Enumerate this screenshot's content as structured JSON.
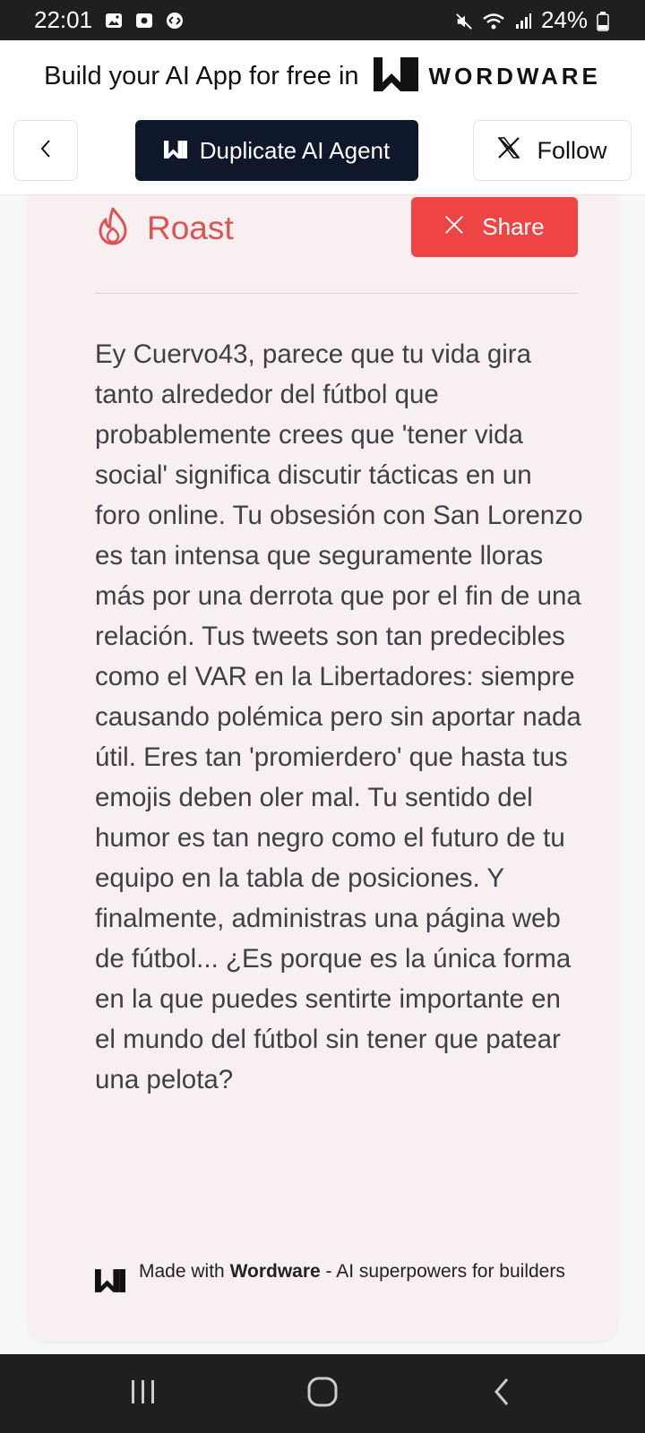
{
  "status_bar": {
    "time": "22:01",
    "battery": "24%",
    "icons": [
      "gallery-icon",
      "screen-record-icon",
      "shazam-icon",
      "mute-icon",
      "wifi-icon",
      "signal-icon",
      "battery-icon"
    ]
  },
  "banner": {
    "text": "Build your AI App for free in",
    "brand": "WORDWARE"
  },
  "action_bar": {
    "duplicate_label": "Duplicate AI Agent",
    "follow_label": "Follow"
  },
  "card": {
    "title": "Roast",
    "share_label": "Share",
    "body": "Ey Cuervo43, parece que tu vida gira tanto alrededor del fútbol que probablemente crees que 'tener vida social' significa discutir tácticas en un foro online. Tu obsesión con San Lorenzo es tan intensa que seguramente lloras más por una derrota que por el fin de una relación. Tus tweets son tan predecibles como el VAR en la Libertadores: siempre causando polémica pero sin aportar nada útil. Eres tan 'promierdero' que hasta tus emojis deben oler mal. Tu sentido del humor es tan negro como el futuro de tu equipo en la tabla de posiciones. Y finalmente, administras una página web de fútbol... ¿Es porque es la única forma en la que puedes sentirte importante en el mundo del fútbol sin tener que patear una pelota?",
    "footer_prefix": "Made with",
    "footer_brand": "Wordware",
    "footer_suffix": "- AI superpowers for builders"
  },
  "colors": {
    "accent_red": "#ef4444",
    "dark_button": "#0f172a",
    "card_bg": "#f7eff0"
  }
}
